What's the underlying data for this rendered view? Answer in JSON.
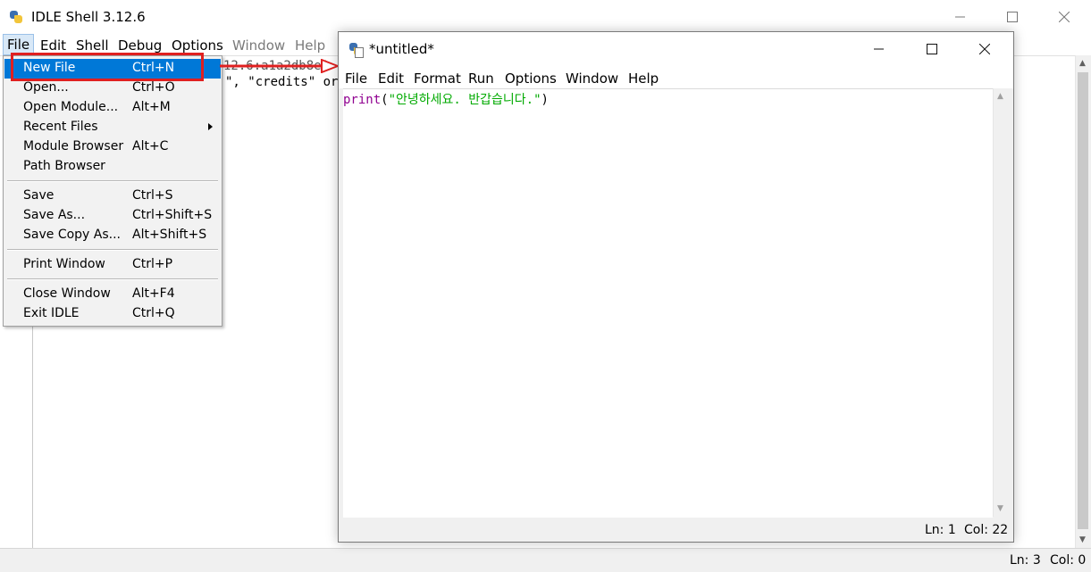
{
  "shell": {
    "title": "IDLE Shell 3.12.6",
    "menu": [
      "File",
      "Edit",
      "Shell",
      "Debug",
      "Options",
      "Window",
      "Help"
    ],
    "code_fragment_1": "12.6:a1a2db8e1",
    "code_fragment_2": "\", \"credits\" or",
    "status": {
      "line": "Ln: 3",
      "col": "Col: 0"
    }
  },
  "file_menu": {
    "items": [
      {
        "label": "New File",
        "shortcut": "Ctrl+N"
      },
      {
        "label": "Open...",
        "shortcut": "Ctrl+O"
      },
      {
        "label": "Open Module...",
        "shortcut": "Alt+M"
      },
      {
        "label": "Recent Files",
        "shortcut": ""
      },
      {
        "label": "Module Browser",
        "shortcut": "Alt+C"
      },
      {
        "label": "Path Browser",
        "shortcut": ""
      },
      {
        "label": "Save",
        "shortcut": "Ctrl+S"
      },
      {
        "label": "Save As...",
        "shortcut": "Ctrl+Shift+S"
      },
      {
        "label": "Save Copy As...",
        "shortcut": "Alt+Shift+S"
      },
      {
        "label": "Print Window",
        "shortcut": "Ctrl+P"
      },
      {
        "label": "Close Window",
        "shortcut": "Alt+F4"
      },
      {
        "label": "Exit IDLE",
        "shortcut": "Ctrl+Q"
      }
    ]
  },
  "editor": {
    "title": "*untitled*",
    "menu": [
      "File",
      "Edit",
      "Format",
      "Run",
      "Options",
      "Window",
      "Help"
    ],
    "code": {
      "func": "print",
      "open": "(",
      "string": "\"안녕하세요. 반갑습니다.\"",
      "close": ")"
    },
    "status": {
      "line": "Ln: 1",
      "col": "Col: 22"
    }
  },
  "colors": {
    "menu_highlight": "#0078d7",
    "annotation_red": "#e02020",
    "builtin_purple": "#900090",
    "string_green": "#00aa00"
  }
}
